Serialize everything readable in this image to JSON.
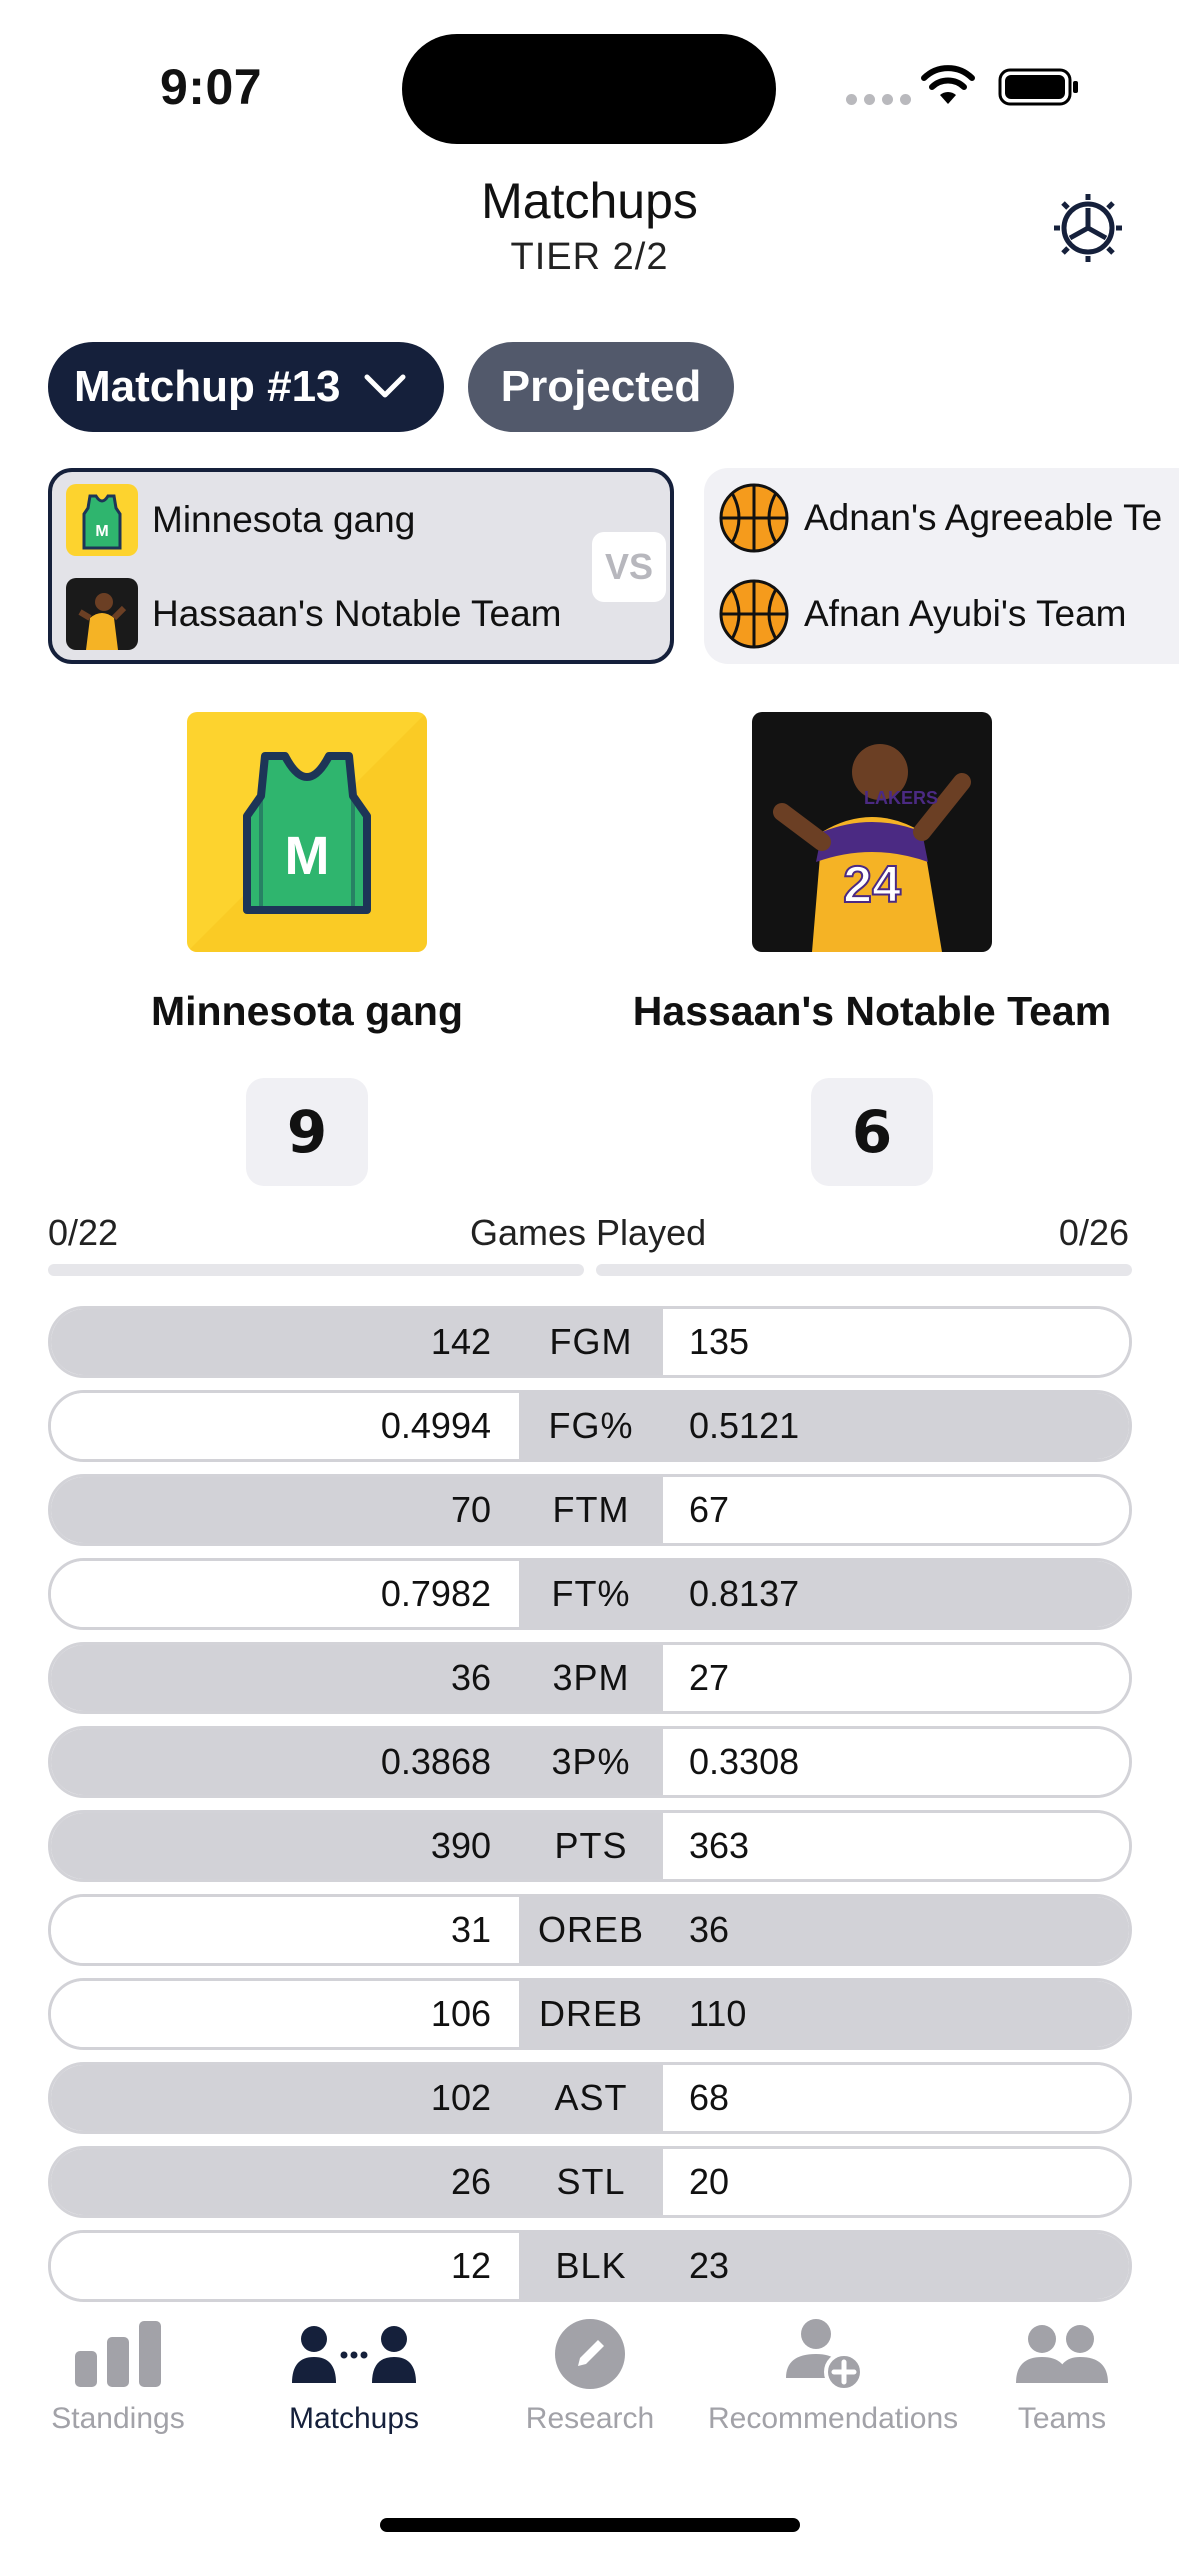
{
  "status": {
    "time": "9:07"
  },
  "header": {
    "title": "Matchups",
    "subtitle": "TIER 2/2"
  },
  "controls": {
    "matchup_label": "Matchup #13",
    "projected_label": "Projected"
  },
  "matchup_cards": [
    {
      "team1": "Minnesota gang",
      "team2": "Hassaan's Notable Team",
      "vs": "VS"
    },
    {
      "team1": "Adnan's Agreeable Te",
      "team2": "Afnan Ayubi's Team"
    }
  ],
  "teams": {
    "left": {
      "name": "Minnesota gang",
      "score": "9",
      "games_played": "0/22",
      "jersey_letter": "M"
    },
    "right": {
      "name": "Hassaan's Notable Team",
      "score": "6",
      "games_played": "0/26",
      "jersey_number": "24",
      "jersey_text": "LAKERS"
    }
  },
  "games_played_label": "Games Played",
  "stats": [
    {
      "cat": "FGM",
      "left": "142",
      "right": "135",
      "winner": "left"
    },
    {
      "cat": "FG%",
      "left": "0.4994",
      "right": "0.5121",
      "winner": "right"
    },
    {
      "cat": "FTM",
      "left": "70",
      "right": "67",
      "winner": "left"
    },
    {
      "cat": "FT%",
      "left": "0.7982",
      "right": "0.8137",
      "winner": "right"
    },
    {
      "cat": "3PM",
      "left": "36",
      "right": "27",
      "winner": "left"
    },
    {
      "cat": "3P%",
      "left": "0.3868",
      "right": "0.3308",
      "winner": "left"
    },
    {
      "cat": "PTS",
      "left": "390",
      "right": "363",
      "winner": "left"
    },
    {
      "cat": "OREB",
      "left": "31",
      "right": "36",
      "winner": "right"
    },
    {
      "cat": "DREB",
      "left": "106",
      "right": "110",
      "winner": "right"
    },
    {
      "cat": "AST",
      "left": "102",
      "right": "68",
      "winner": "left"
    },
    {
      "cat": "STL",
      "left": "26",
      "right": "20",
      "winner": "left"
    },
    {
      "cat": "BLK",
      "left": "12",
      "right": "23",
      "winner": "right"
    }
  ],
  "tabs": [
    {
      "label": "Standings",
      "icon": "bar-chart-icon",
      "active": false
    },
    {
      "label": "Matchups",
      "icon": "matchups-icon",
      "active": true
    },
    {
      "label": "Research",
      "icon": "pencil-icon",
      "active": false
    },
    {
      "label": "Recommendations",
      "icon": "add-person-icon",
      "active": false
    },
    {
      "label": "Teams",
      "icon": "people-icon",
      "active": false
    }
  ],
  "colors": {
    "navy": "#15203b",
    "slate": "#52596b",
    "win_gray": "#d2d2d7",
    "jersey_yellow": "#fdd32e",
    "jersey_green": "#2fb56e",
    "lakers_gold": "#f5b325"
  }
}
